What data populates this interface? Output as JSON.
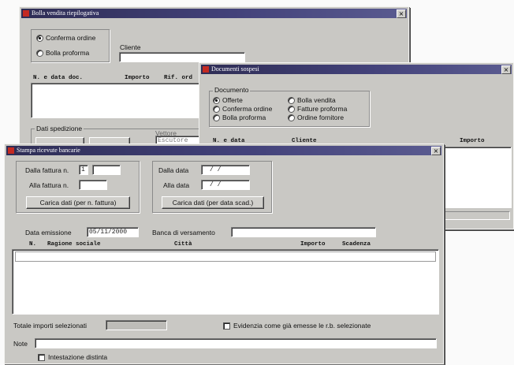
{
  "win1": {
    "title": "Bolla vendita riepilogativa",
    "close": "×",
    "radio_conferma": "Conferma ordine",
    "radio_bolla": "Bolla proforma",
    "cliente_label": "Cliente",
    "cliente_value": "",
    "col_ndata": "N. e data doc.",
    "col_importo": "Importo",
    "col_rif": "Rif. ord",
    "dati_spedizione": "Dati spedizione",
    "vettore_label": "Vettore",
    "vettore_value": "Escutore"
  },
  "win2": {
    "title": "Documenti sospesi",
    "close": "×",
    "group_title": "Documento",
    "radio_offerte": "Offerte",
    "radio_conferma": "Conferma ordine",
    "radio_bolla": "Bolla proforma",
    "radio_bolla_vendita": "Bolla vendita",
    "radio_fatture": "Fatture proforma",
    "radio_ordine": "Ordine fornitore",
    "col_ndata": "N. e data",
    "col_cliente": "Cliente",
    "col_importo": "Importo"
  },
  "win3": {
    "title": "Stampa ricevute bancarie",
    "close": "×",
    "dalla_fattura_label": "Dalla fattura n.",
    "dalla_fattura_value": "1",
    "alla_fattura_label": "Alla fattura n.",
    "alla_fattura_value": "",
    "btn_carica_fattura": "Carica dati (per n. fattura)",
    "dalla_data_label": "Dalla data",
    "dalla_data_value": "/   /",
    "alla_data_label": "Alla data",
    "alla_data_value": "/   /",
    "btn_carica_data": "Carica dati (per data scad.)",
    "data_emissione_label": "Data emissione",
    "data_emissione_value": "05/11/2000",
    "banca_label": "Banca di versamento",
    "banca_value": "",
    "col_n": "N.",
    "col_ragione": "Ragione sociale",
    "col_citta": "Città",
    "col_importo": "Importo",
    "col_scadenza": "Scadenza",
    "totale_label": "Totale importi selezionati",
    "totale_value": "",
    "evidenzia_label": "Evidenzia come già emesse le r.b. selezionate",
    "note_label": "Note",
    "note_value": "",
    "intestazione_label": "Intestazione distinta"
  }
}
